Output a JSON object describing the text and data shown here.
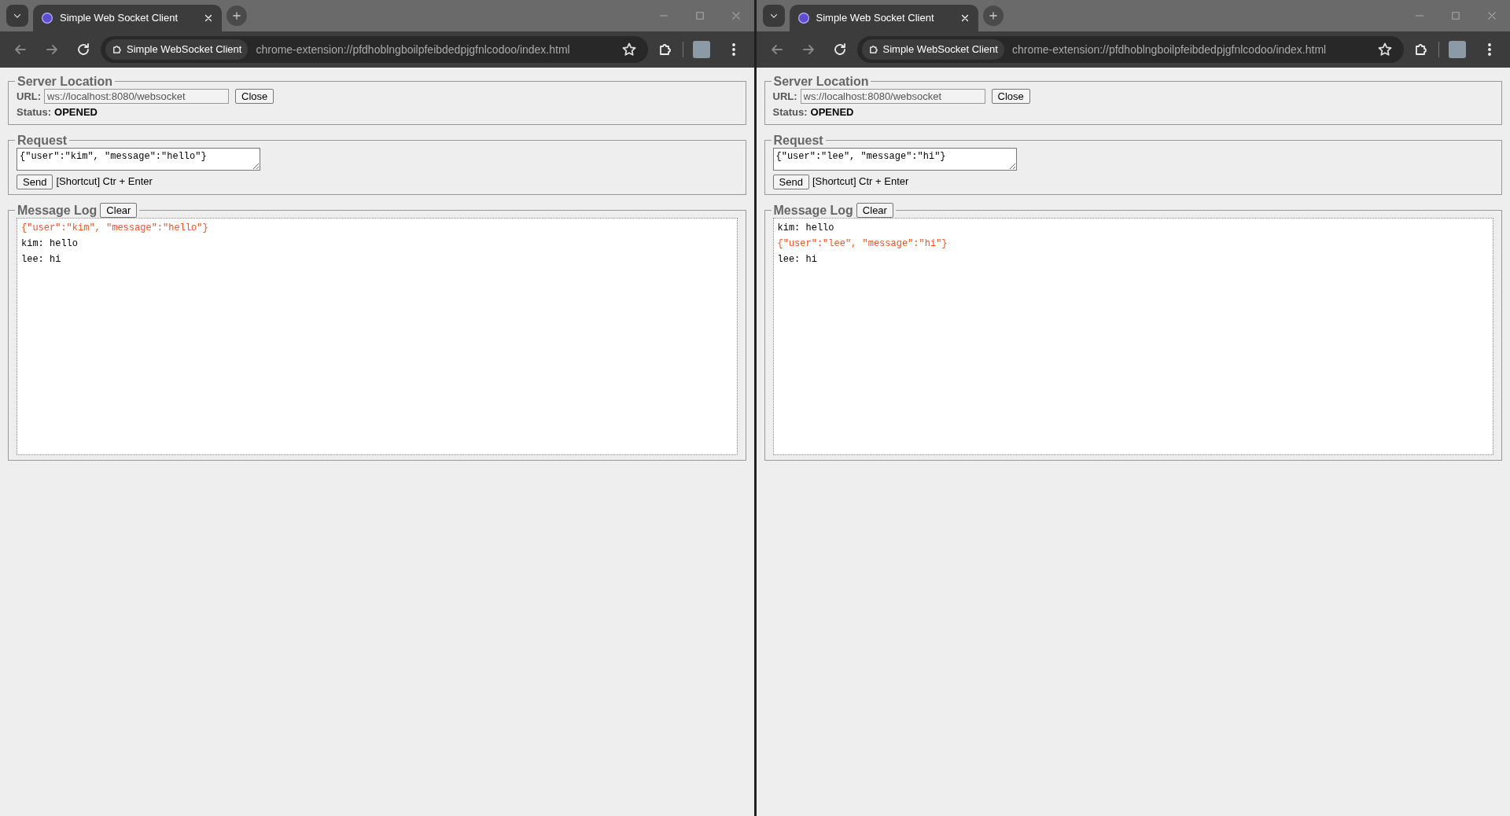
{
  "windows": [
    {
      "tab": {
        "title": "Simple Web Socket Client"
      },
      "address_bar": {
        "site_chip": "Simple WebSocket Client",
        "url": "chrome-extension://pfdhoblngboilpfeibdedpjgfnlcodoo/index.html"
      },
      "page": {
        "server_location": {
          "legend": "Server Location",
          "url_label": "URL:",
          "url_value": "ws://localhost:8080/websocket",
          "close_button": "Close",
          "status_label": "Status:",
          "status_value": "OPENED"
        },
        "request": {
          "legend": "Request",
          "value": "{\"user\":\"kim\", \"message\":\"hello\"}",
          "send_button": "Send",
          "shortcut_hint": "[Shortcut] Ctr + Enter"
        },
        "message_log": {
          "legend": "Message Log",
          "clear_button": "Clear",
          "entries": [
            {
              "kind": "sent",
              "text": "{\"user\":\"kim\", \"message\":\"hello\"}"
            },
            {
              "kind": "received",
              "text": "kim: hello"
            },
            {
              "kind": "received",
              "text": "lee: hi"
            }
          ]
        }
      }
    },
    {
      "tab": {
        "title": "Simple Web Socket Client"
      },
      "address_bar": {
        "site_chip": "Simple WebSocket Client",
        "url": "chrome-extension://pfdhoblngboilpfeibdedpjgfnlcodoo/index.html"
      },
      "page": {
        "server_location": {
          "legend": "Server Location",
          "url_label": "URL:",
          "url_value": "ws://localhost:8080/websocket",
          "close_button": "Close",
          "status_label": "Status:",
          "status_value": "OPENED"
        },
        "request": {
          "legend": "Request",
          "value": "{\"user\":\"lee\", \"message\":\"hi\"}",
          "send_button": "Send",
          "shortcut_hint": "[Shortcut] Ctr + Enter"
        },
        "message_log": {
          "legend": "Message Log",
          "clear_button": "Clear",
          "entries": [
            {
              "kind": "received",
              "text": "kim: hello"
            },
            {
              "kind": "sent",
              "text": "{\"user\":\"lee\", \"message\":\"hi\"}"
            },
            {
              "kind": "received",
              "text": "lee: hi"
            }
          ]
        }
      }
    }
  ]
}
